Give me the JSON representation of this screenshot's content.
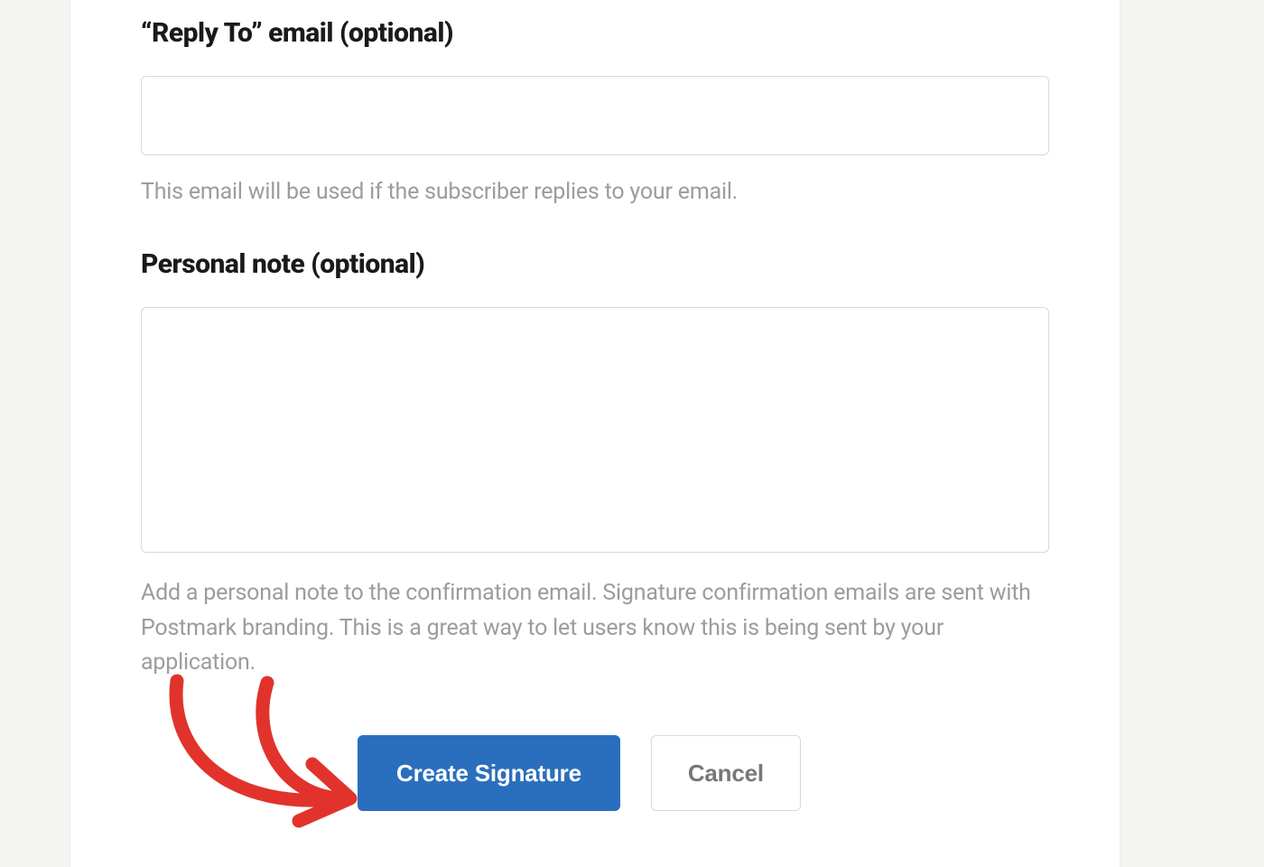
{
  "form": {
    "reply_to": {
      "label": "“Reply To” email (optional)",
      "value": "",
      "help": "This email will be used if the subscriber replies to your email."
    },
    "personal_note": {
      "label": "Personal note (optional)",
      "value": "",
      "help": "Add a personal note to the confirmation email. Signature confirmation emails are sent with Postmark branding. This is a great way to let users know this is being sent by your application."
    },
    "actions": {
      "submit_label": "Create Signature",
      "cancel_label": "Cancel"
    }
  },
  "annotation": {
    "arrow_color": "#e1332b"
  }
}
